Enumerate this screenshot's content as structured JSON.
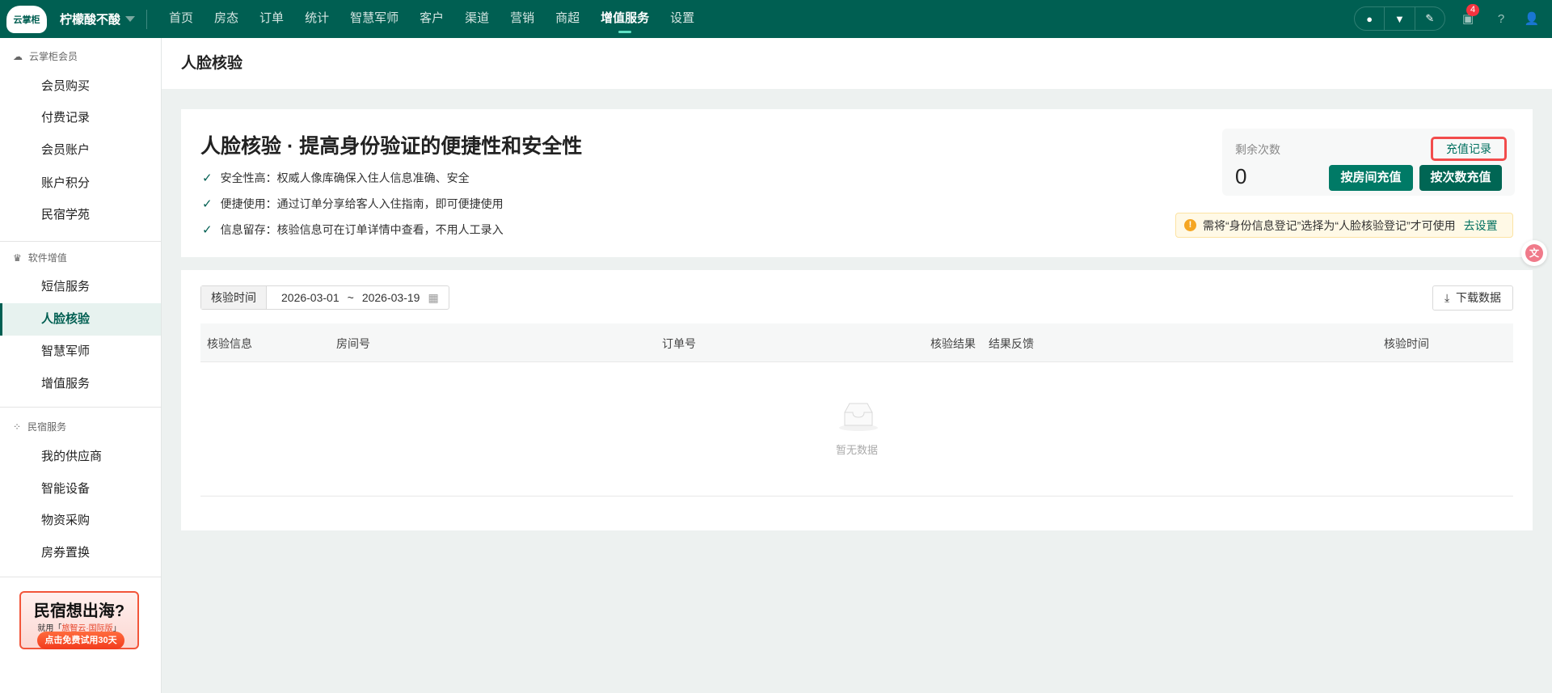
{
  "topbar": {
    "logo": "云掌柜",
    "shop": "柠檬酸不酸",
    "nav": [
      "首页",
      "房态",
      "订单",
      "统计",
      "智慧军师",
      "客户",
      "渠道",
      "营销",
      "商超",
      "增值服务",
      "设置"
    ],
    "active_nav": "增值服务",
    "message_count": "4"
  },
  "sidebar": {
    "sections": [
      {
        "title": "云掌柜会员",
        "items": [
          "会员购买",
          "付费记录",
          "会员账户",
          "账户积分",
          "民宿学苑"
        ]
      },
      {
        "title": "软件增值",
        "items": [
          "短信服务",
          "人脸核验",
          "智慧军师",
          "增值服务"
        ]
      },
      {
        "title": "民宿服务",
        "items": [
          "我的供应商",
          "智能设备",
          "物资采购",
          "房券置换"
        ]
      }
    ],
    "active_item": "人脸核验",
    "banner": {
      "title": "民宿想出海?",
      "sub_prefix": "就用「",
      "sub_brand": "旅智云·国际版",
      "sub_suffix": "」",
      "cta": "点击免费试用30天"
    }
  },
  "page": {
    "title": "人脸核验"
  },
  "intro": {
    "heading": "人脸核验 · 提高身份验证的便捷性和安全性",
    "features": [
      "安全性高：权威人像库确保入住人信息准确、安全",
      "便捷使用：通过订单分享给客人入住指南，即可便捷使用",
      "信息留存：核验信息可在订单详情中查看，不用人工录入"
    ]
  },
  "balance": {
    "label": "剩余次数",
    "value": "0",
    "record_link": "充值记录",
    "btn_room": "按房间充值",
    "btn_count": "按次数充值"
  },
  "warning": {
    "text": "需将“身份信息登记”选择为“人脸核验登记”才可使用",
    "link": "去设置"
  },
  "filter": {
    "label": "核验时间",
    "start": "2026-03-01",
    "sep": "~",
    "end": "2026-03-19",
    "download": "下载数据"
  },
  "table": {
    "columns": [
      "核验信息",
      "房间号",
      "订单号",
      "核验结果",
      "结果反馈",
      "核验时间"
    ],
    "empty": "暂无数据"
  },
  "colors": {
    "brand": "#005f52",
    "accent": "#007a66"
  }
}
